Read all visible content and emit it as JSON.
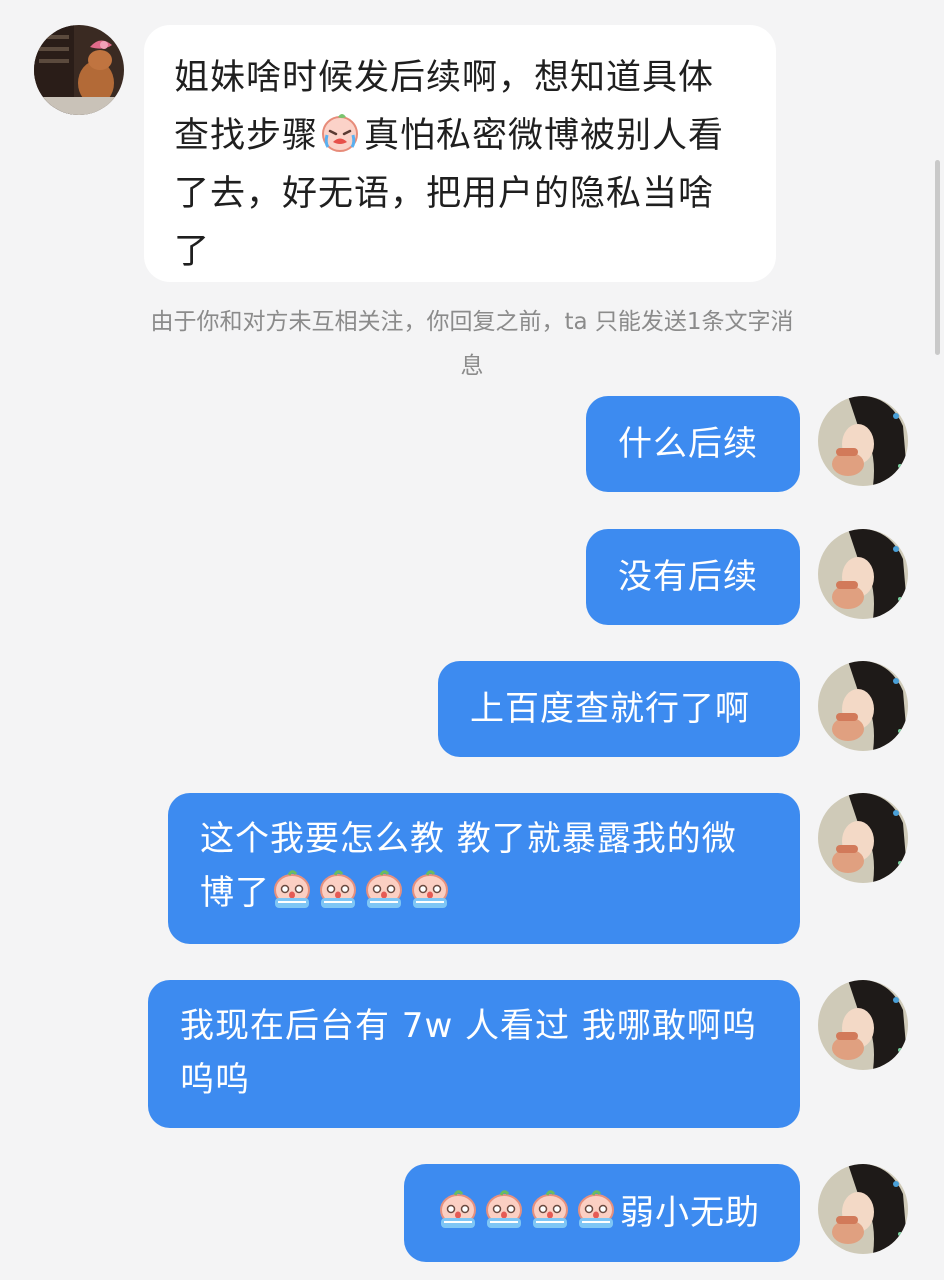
{
  "incoming": {
    "line1": "姐妹啥时候发后续啊，想知道具体",
    "line2_a": "查找步骤",
    "line2_b": "真怕私密微博被别人看",
    "line3": "了去，好无语，把用户的隐私当啥",
    "line4": "了"
  },
  "notice": {
    "line1": "由于你和对方未互相关注，你回复之前，ta 只能发送1条文字消",
    "line2": "息"
  },
  "outgoing": [
    {
      "text": "什么后续"
    },
    {
      "text": "没有后续"
    },
    {
      "text": "上百度查就行了啊"
    },
    {
      "line1": "这个我要怎么教 教了就暴露我的微",
      "line2": "博了"
    },
    {
      "line1": "我现在后台有 7w 人看过 我哪敢啊呜",
      "line2": "呜呜"
    },
    {
      "text": "弱小无助"
    }
  ],
  "emoji": {
    "crying_peach": "crying-peach-icon",
    "crying": "crying-face-icon"
  },
  "colors": {
    "background": "#f4f4f5",
    "incoming_bubble": "#ffffff",
    "outgoing_bubble": "#3d8bf0",
    "notice_text": "#8b8b8b"
  }
}
